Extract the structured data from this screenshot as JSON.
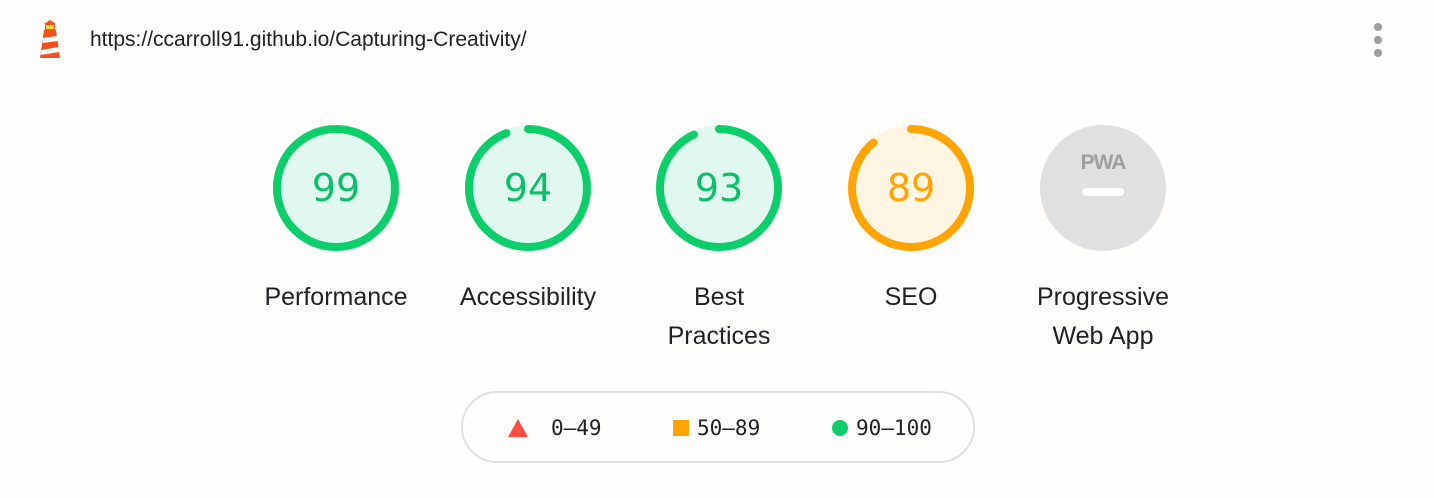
{
  "header": {
    "url": "https://ccarroll91.github.io/Capturing-Creativity/",
    "logo_icon": "lighthouse-icon",
    "menu_icon": "more-vert-icon"
  },
  "colors": {
    "pass": "#0cce6b",
    "pass_bg": "#e0f8ef",
    "pass_text": "#008b4c",
    "average": "#ffa400",
    "average_bg": "#fff5e3",
    "average_text": "#c33300",
    "fail": "#ff4e42",
    "na": "#e0e0e0",
    "na_text": "#9e9e9e"
  },
  "gauges": [
    {
      "id": "performance",
      "score": 99,
      "label_lines": [
        "Performance"
      ],
      "status": "pass"
    },
    {
      "id": "accessibility",
      "score": 94,
      "label_lines": [
        "Accessibility"
      ],
      "status": "pass"
    },
    {
      "id": "best-practices",
      "score": 93,
      "label_lines": [
        "Best",
        "Practices"
      ],
      "status": "pass"
    },
    {
      "id": "seo",
      "score": 89,
      "label_lines": [
        "SEO"
      ],
      "status": "average"
    },
    {
      "id": "pwa",
      "score": null,
      "label_lines": [
        "Progressive",
        "Web App"
      ],
      "status": "na",
      "badge_text": "PWA"
    }
  ],
  "legend": {
    "items": [
      {
        "range": "0–49",
        "shape": "triangle",
        "status": "fail"
      },
      {
        "range": "50–89",
        "shape": "square",
        "status": "average"
      },
      {
        "range": "90–100",
        "shape": "circle",
        "status": "pass"
      }
    ]
  }
}
